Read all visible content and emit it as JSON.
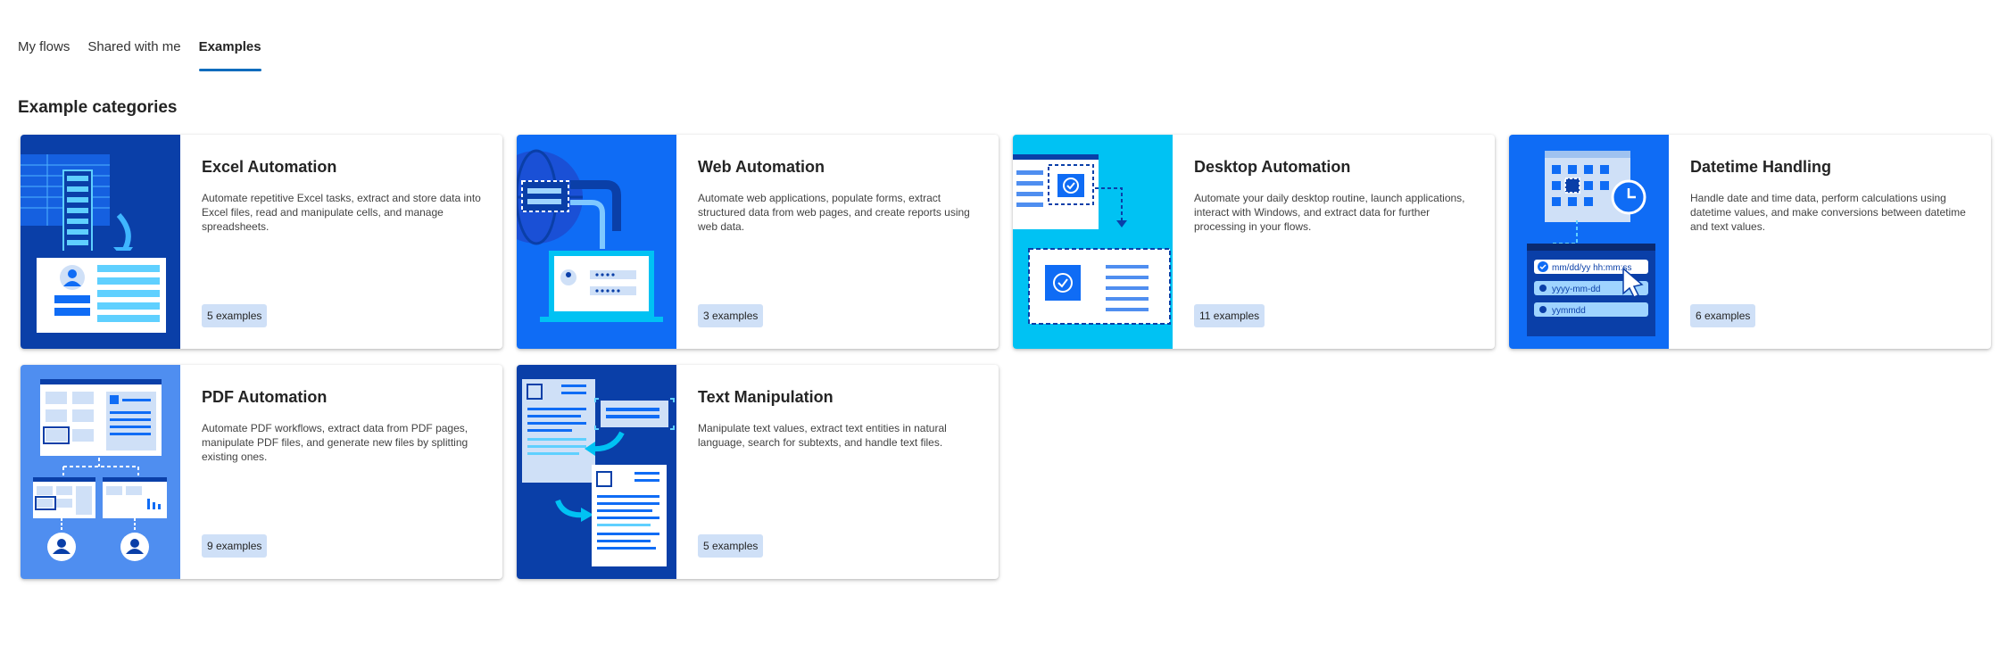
{
  "tabs": [
    {
      "label": "My flows",
      "active": false
    },
    {
      "label": "Shared with me",
      "active": false
    },
    {
      "label": "Examples",
      "active": true
    }
  ],
  "section_title": "Example categories",
  "categories": [
    {
      "title": "Excel Automation",
      "description": "Automate repetitive Excel tasks, extract and store data into Excel files, read and manipulate cells, and manage spreadsheets.",
      "count": "5 examples",
      "icon": "excel-illustration"
    },
    {
      "title": "Web Automation",
      "description": "Automate web applications, populate forms, extract structured data from web pages, and create reports using web data.",
      "count": "3 examples",
      "icon": "web-illustration"
    },
    {
      "title": "Desktop Automation",
      "description": "Automate your daily desktop routine, launch applications, interact with Windows, and extract data for further processing in your flows.",
      "count": "11 examples",
      "icon": "desktop-illustration"
    },
    {
      "title": "Datetime Handling",
      "description": "Handle date and time data, perform calculations using datetime values, and make conversions between datetime and text values.",
      "count": "6 examples",
      "icon": "datetime-illustration",
      "formats": [
        "mm/dd/yy hh:mm:ss",
        "yyyy-mm-dd",
        "yymmdd"
      ]
    },
    {
      "title": "PDF Automation",
      "description": "Automate PDF workflows, extract data from PDF pages, manipulate PDF files, and generate new files by splitting existing ones.",
      "count": "9 examples",
      "icon": "pdf-illustration"
    },
    {
      "title": "Text Manipulation",
      "description": "Manipulate text values, extract text entities in natural language, search for subtexts, and handle text files.",
      "count": "5 examples",
      "icon": "text-illustration"
    }
  ],
  "colors": {
    "accent": "#0f6cbd",
    "badge_bg": "#cfe0f7",
    "thumb_dark": "#0a3fa8",
    "thumb_blue": "#0f6cf5",
    "thumb_cyan": "#00c2f3",
    "thumb_light": "#4f8ef0"
  }
}
